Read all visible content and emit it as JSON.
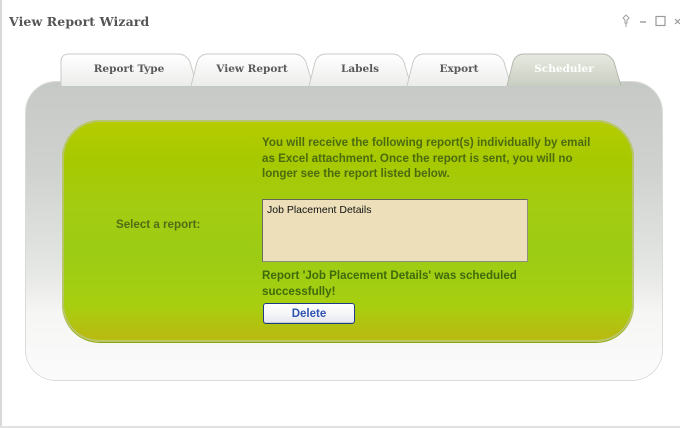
{
  "window": {
    "title": "View Report Wizard"
  },
  "titlebar_controls": [
    {
      "name": "pin-icon",
      "glyph": "pin"
    },
    {
      "name": "minimize-icon",
      "glyph": "minimize"
    },
    {
      "name": "maximize-icon",
      "glyph": "maximize"
    },
    {
      "name": "close-icon",
      "glyph": "close"
    }
  ],
  "tabs": [
    {
      "label": "Report Type",
      "active": false
    },
    {
      "label": "View Report",
      "active": false
    },
    {
      "label": "Labels",
      "active": false
    },
    {
      "label": "Export",
      "active": false
    },
    {
      "label": "Scheduler",
      "active": true
    }
  ],
  "scheduler": {
    "info_text": "You will receive the following report(s) individually by email as Excel attachment. Once the report is sent, you will no longer see the report listed below.",
    "select_label": "Select a report:",
    "reports": [
      "Job Placement Details"
    ],
    "status_message": "Report 'Job Placement Details' was scheduled successfully!",
    "delete_label": "Delete"
  },
  "colors": {
    "panel_green": "#a3cc12",
    "text_green": "#4c6b10",
    "list_background": "#ecdfb9",
    "button_text": "#2f55b2",
    "active_tab": "#d3d8c9"
  }
}
